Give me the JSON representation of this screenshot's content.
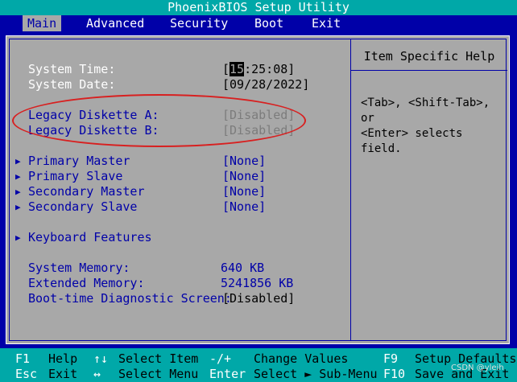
{
  "title": "PhoenixBIOS Setup Utility",
  "menu": [
    {
      "label": "Main",
      "active": true
    },
    {
      "label": "Advanced"
    },
    {
      "label": "Security"
    },
    {
      "label": "Boot"
    },
    {
      "label": "Exit"
    }
  ],
  "fields": {
    "system_time": {
      "label": "System Time:",
      "value_cursor": "15",
      "value_rest": ":25:08]",
      "value_open": "["
    },
    "system_date": {
      "label": "System Date:",
      "value": "[09/28/2022]"
    },
    "diskette_a": {
      "label": "Legacy Diskette A:",
      "value": "[Disabled]"
    },
    "diskette_b": {
      "label": "Legacy Diskette B:",
      "value": "[Disabled]"
    },
    "primary_master": {
      "label": "Primary Master",
      "value": "[None]"
    },
    "primary_slave": {
      "label": "Primary Slave",
      "value": "[None]"
    },
    "secondary_master": {
      "label": "Secondary Master",
      "value": "[None]"
    },
    "secondary_slave": {
      "label": "Secondary Slave",
      "value": "[None]"
    },
    "keyboard_features": {
      "label": "Keyboard Features"
    },
    "system_memory": {
      "label": "System Memory:",
      "value": "640 KB"
    },
    "extended_memory": {
      "label": "Extended Memory:",
      "value": "5241856 KB"
    },
    "boot_diag": {
      "label": "Boot-time Diagnostic Screen:",
      "value": "[Disabled]"
    }
  },
  "help": {
    "title": "Item Specific Help",
    "text": "<Tab>, <Shift-Tab>, or\n<Enter> selects field."
  },
  "footer": {
    "row1": [
      {
        "key": "F1",
        "desc": "Help"
      },
      {
        "key": "↑↓",
        "desc": "Select Item"
      },
      {
        "key": "-/+",
        "desc": "Change Values"
      },
      {
        "key": "F9",
        "desc": "Setup Defaults"
      }
    ],
    "row2": [
      {
        "key": "Esc",
        "desc": "Exit"
      },
      {
        "key": "↔",
        "desc": "Select Menu"
      },
      {
        "key": "Enter",
        "desc": "Select ► Sub-Menu"
      },
      {
        "key": "F10",
        "desc": "Save and Exit"
      }
    ]
  },
  "watermark": "CSDN @yleih",
  "colors": {
    "background": "#0000a8",
    "panel": "#a8a8a8",
    "bar": "#00a8a8",
    "annotation": "#d82020"
  }
}
